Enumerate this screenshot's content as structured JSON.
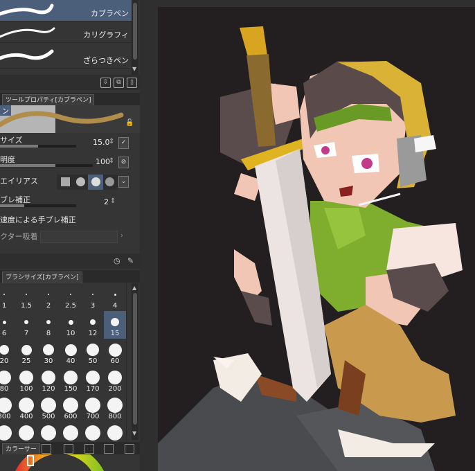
{
  "subtools": [
    {
      "label": "カブラペン",
      "selected": true
    },
    {
      "label": "カリグラフィ",
      "selected": false
    },
    {
      "label": "ざらつきペン",
      "selected": false
    }
  ],
  "subtool_toolbar_icons": [
    "download-icon",
    "duplicate-icon",
    "delete-icon"
  ],
  "tool_property": {
    "tab_label": "ツールプロパティ[カブラペン]",
    "preview_tag": "ン",
    "rows": [
      {
        "label": "サイズ",
        "value": "15.0",
        "fill": 0.55
      },
      {
        "label": "明度",
        "value": "100",
        "fill": 0.6
      },
      {
        "label": "エイリアス"
      },
      {
        "label": "ブレ補正",
        "value": "2",
        "fill": 0.35
      },
      {
        "label": "速度による手ブレ補正"
      },
      {
        "label": "クター吸着"
      }
    ]
  },
  "brush_size": {
    "tab_label": "ブラシサイズ[カブラペン]",
    "sizes": [
      "1",
      "1.5",
      "2",
      "2.5",
      "3",
      "4",
      "6",
      "7",
      "8",
      "10",
      "12",
      "15",
      "20",
      "25",
      "30",
      "40",
      "50",
      "60",
      "80",
      "100",
      "120",
      "150",
      "170",
      "200",
      "300",
      "400",
      "500",
      "600",
      "700",
      "800",
      "",
      "",
      "",
      "",
      "",
      ""
    ],
    "selected": "15"
  },
  "color_tab": {
    "label": "カラーサー"
  },
  "colors": {
    "selection": "#4b5e7a",
    "panel": "#353535",
    "canvas_bg": "#2f2f2f",
    "art_bg": "#231e1f"
  }
}
